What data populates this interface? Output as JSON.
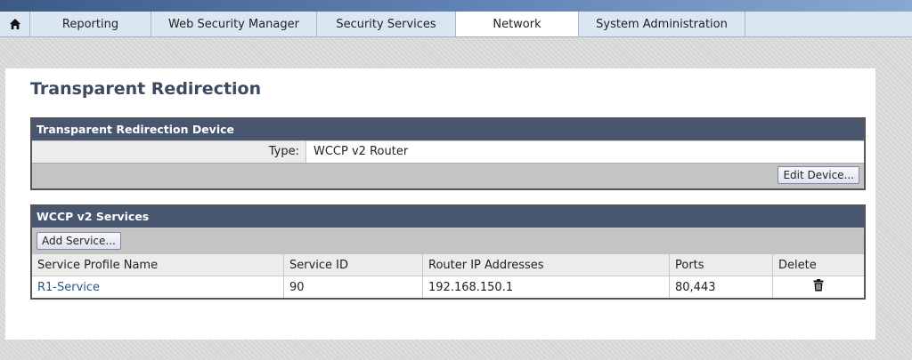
{
  "nav": {
    "tabs": [
      {
        "label": "Reporting",
        "active": false
      },
      {
        "label": "Web Security Manager",
        "active": false
      },
      {
        "label": "Security Services",
        "active": false
      },
      {
        "label": "Network",
        "active": true
      },
      {
        "label": "System Administration",
        "active": false
      }
    ],
    "home_icon": "home-icon"
  },
  "page": {
    "title": "Transparent Redirection"
  },
  "device": {
    "header": "Transparent Redirection Device",
    "type_label": "Type:",
    "type_value": "WCCP v2 Router",
    "edit_button": "Edit Device..."
  },
  "services": {
    "header": "WCCP v2 Services",
    "add_button": "Add Service...",
    "columns": [
      "Service Profile Name",
      "Service ID",
      "Router IP Addresses",
      "Ports",
      "Delete"
    ],
    "rows": [
      {
        "name": "R1-Service",
        "service_id": "90",
        "router_ips": "192.168.150.1",
        "ports": "80,443",
        "delete_icon": "trash-icon"
      }
    ]
  },
  "colors": {
    "box_header": "#48566f",
    "tab_bg": "#dae6f2",
    "link": "#275682"
  }
}
